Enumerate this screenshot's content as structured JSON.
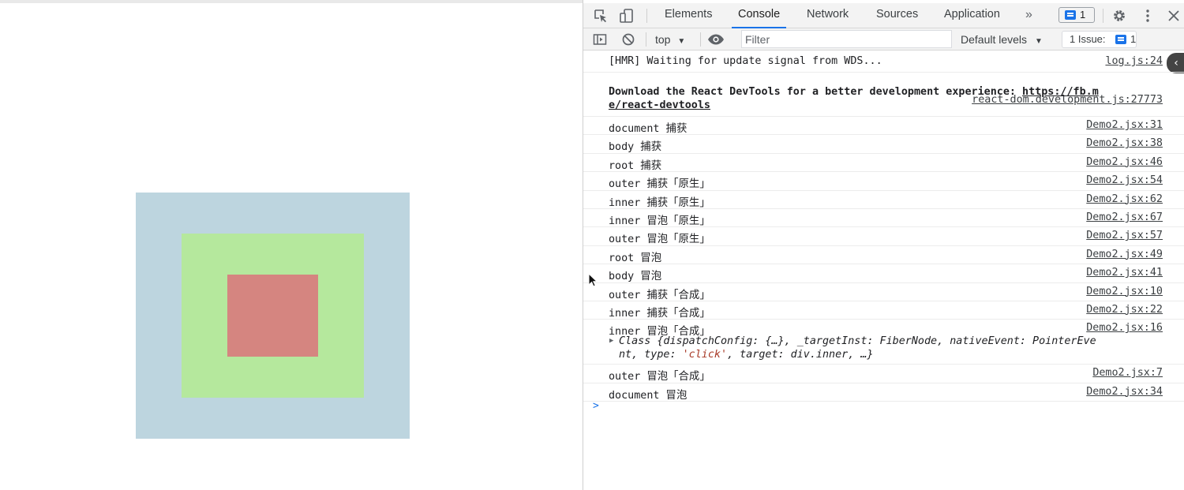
{
  "page": {
    "colors": {
      "outer": "#bdd5df",
      "middle": "#b5e89d",
      "inner": "#d58580"
    }
  },
  "devtools": {
    "tabs": [
      "Elements",
      "Console",
      "Network",
      "Sources",
      "Application"
    ],
    "active_tab": "Console",
    "more_tabs": "»",
    "message_count": "1",
    "toolbar": {
      "context": "top",
      "filter_placeholder": "Filter",
      "levels": "Default levels",
      "issues_label": "1 Issue:",
      "issues_count": "1"
    },
    "messages": [
      {
        "text": "[HMR] Waiting for update signal from WDS...",
        "source": "log.js:24"
      },
      {
        "source": "react-dom.development.js:27773",
        "line1": "Download the React DevTools for a better development experience: ",
        "link1": "https://fb.m",
        "link2": "e/react-devtools"
      },
      {
        "text": "document 捕获",
        "source": "Demo2.jsx:31"
      },
      {
        "text": "body 捕获",
        "source": "Demo2.jsx:38"
      },
      {
        "text": "root 捕获",
        "source": "Demo2.jsx:46"
      },
      {
        "text": "outer 捕获「原生」",
        "source": "Demo2.jsx:54"
      },
      {
        "text": "inner 捕获「原生」",
        "source": "Demo2.jsx:62"
      },
      {
        "text": "inner 冒泡「原生」",
        "source": "Demo2.jsx:67"
      },
      {
        "text": "outer 冒泡「原生」",
        "source": "Demo2.jsx:57"
      },
      {
        "text": "root 冒泡",
        "source": "Demo2.jsx:49"
      },
      {
        "text": "body 冒泡",
        "source": "Demo2.jsx:41"
      },
      {
        "text": "outer 捕获「合成」",
        "source": "Demo2.jsx:10"
      },
      {
        "text": "inner 捕获「合成」",
        "source": "Demo2.jsx:22"
      },
      {
        "text": "inner 冒泡「合成」",
        "source": "Demo2.jsx:16",
        "obj_line1": "Class {dispatchConfig: {…}, _targetInst: FiberNode, nativeEvent: PointerEve",
        "obj_line2_a": "nt, type: ",
        "obj_line2_str": "'click'",
        "obj_line2_b": ", target: div.inner, …}"
      },
      {
        "text": "outer 冒泡「合成」",
        "source": "Demo2.jsx:7"
      },
      {
        "text": "document 冒泡",
        "source": "Demo2.jsx:34"
      }
    ],
    "prompt": ">"
  }
}
